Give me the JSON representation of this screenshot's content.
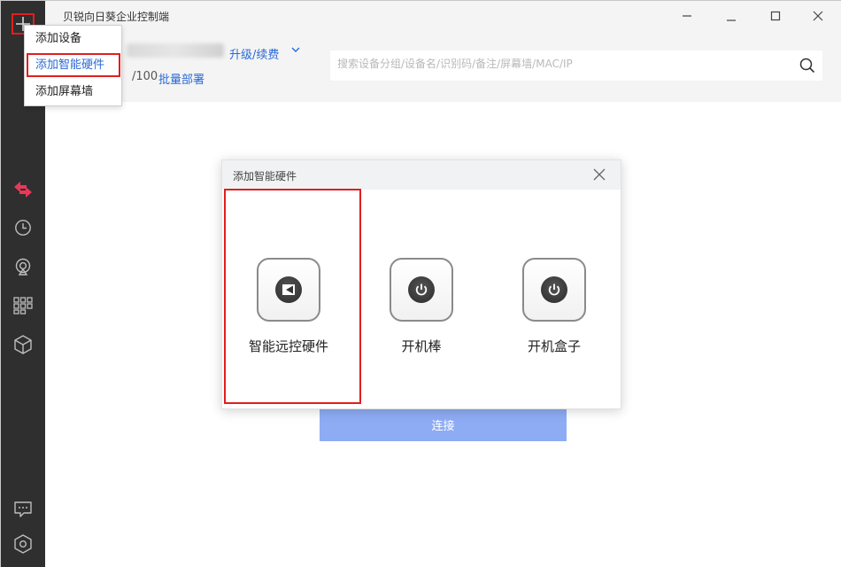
{
  "app": {
    "title": "贝锐向日葵企业控制端"
  },
  "header": {
    "upgrade_label": "升级/续费",
    "device_count": "/100",
    "batch_deploy_label": "批量部署"
  },
  "search": {
    "placeholder": "搜索设备分组/设备名/识别码/备注/屏幕墙/MAC/IP"
  },
  "main": {
    "connect_label": "连接"
  },
  "add_menu": {
    "items": [
      {
        "label": "添加设备"
      },
      {
        "label": "添加智能硬件"
      },
      {
        "label": "添加屏幕墙"
      }
    ]
  },
  "dialog": {
    "title": "添加智能硬件",
    "items": [
      {
        "label": "智能远控硬件",
        "icon": "remote-control-hardware-icon"
      },
      {
        "label": "开机棒",
        "icon": "power-icon"
      },
      {
        "label": "开机盒子",
        "icon": "power-icon"
      }
    ]
  },
  "colors": {
    "accent": "#2a6ad8",
    "highlight": "#e01f1f",
    "sidebar": "#2f2f2f",
    "connect": "#8eacf4"
  }
}
